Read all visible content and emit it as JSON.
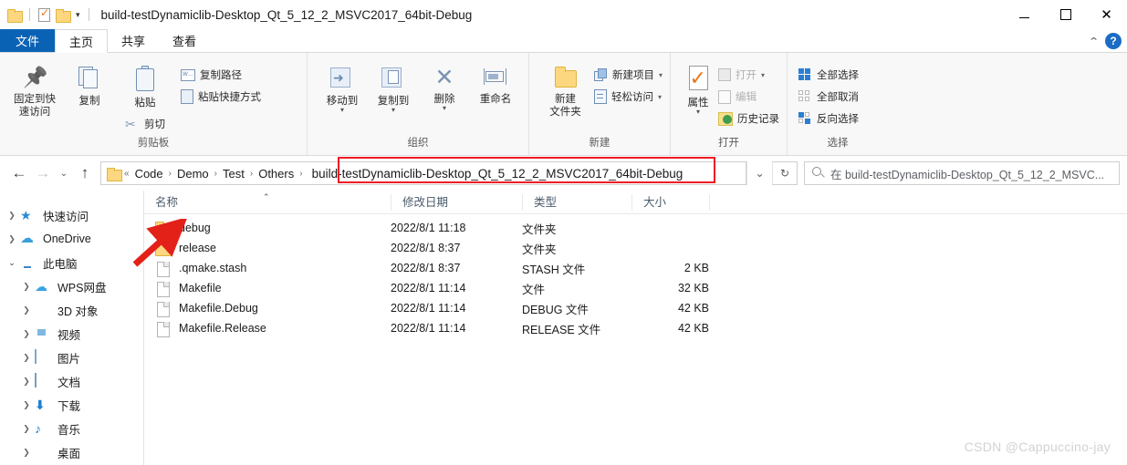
{
  "window": {
    "title": "build-testDynamiclib-Desktop_Qt_5_12_2_MSVC2017_64bit-Debug",
    "quick_access": [
      "folder-icon",
      "properties-icon",
      "folder-icon",
      "chevron-down-icon"
    ],
    "controls": {
      "minimize": "minimize-icon",
      "maximize": "maximize-icon",
      "close": "✕"
    }
  },
  "tabs": {
    "file": "文件",
    "items": [
      {
        "label": "主页",
        "active": true
      },
      {
        "label": "共享",
        "active": false
      },
      {
        "label": "查看",
        "active": false
      }
    ],
    "collapse": "︿",
    "help": "?"
  },
  "ribbon": {
    "groups": [
      {
        "label": "剪贴板",
        "big": [
          {
            "label": "固定到快\n速访问",
            "icon": "pin-icon"
          },
          {
            "label": "复制",
            "icon": "copy-icon"
          },
          {
            "label": "粘贴",
            "icon": "paste-icon"
          }
        ],
        "cut": {
          "label": "剪切",
          "icon": "scissors-icon"
        },
        "small": [
          {
            "label": "复制路径",
            "icon": "copy-path-icon"
          },
          {
            "label": "粘贴快捷方式",
            "icon": "paste-shortcut-icon"
          }
        ]
      },
      {
        "label": "组织",
        "big": [
          {
            "label": "移动到",
            "icon": "move-to-icon",
            "caret": true
          },
          {
            "label": "复制到",
            "icon": "copy-to-icon",
            "caret": true
          },
          {
            "label": "删除",
            "icon": "delete-icon",
            "caret": true
          },
          {
            "label": "重命名",
            "icon": "rename-icon"
          }
        ]
      },
      {
        "label": "新建",
        "big": [
          {
            "label": "新建\n文件夹",
            "icon": "new-folder-icon"
          }
        ],
        "small": [
          {
            "label": "新建项目",
            "icon": "new-item-icon",
            "caret": true
          },
          {
            "label": "轻松访问",
            "icon": "easy-access-icon",
            "caret": true
          }
        ]
      },
      {
        "label": "打开",
        "big": [
          {
            "label": "属性",
            "icon": "properties-icon",
            "caret": true
          }
        ],
        "small": [
          {
            "label": "打开",
            "icon": "open-icon",
            "caret": true,
            "disabled": true
          },
          {
            "label": "编辑",
            "icon": "edit-icon",
            "disabled": true
          },
          {
            "label": "历史记录",
            "icon": "history-icon"
          }
        ]
      },
      {
        "label": "选择",
        "small": [
          {
            "label": "全部选择",
            "icon": "select-all-icon"
          },
          {
            "label": "全部取消",
            "icon": "deselect-all-icon"
          },
          {
            "label": "反向选择",
            "icon": "invert-selection-icon"
          }
        ]
      }
    ]
  },
  "addressbar": {
    "back": "←",
    "forward": "→",
    "recent": "⌄",
    "up": "↑",
    "breadcrumb": [
      "Code",
      "Demo",
      "Test",
      "Others"
    ],
    "prefix": "«",
    "current": "build-testDynamiclib-Desktop_Qt_5_12_2_MSVC2017_64bit-Debug",
    "dropdown": "⌄",
    "refresh": "↻",
    "search_placeholder": "在 build-testDynamiclib-Desktop_Qt_5_12_2_MSVC..."
  },
  "sidebar": {
    "items": [
      {
        "label": "快速访问",
        "icon": "star-icon",
        "level": 1,
        "expanded": false
      },
      {
        "label": "OneDrive",
        "icon": "cloud-icon",
        "level": 1,
        "expanded": false
      },
      {
        "label": "此电脑",
        "icon": "this-pc-icon",
        "level": 1,
        "expanded": true
      },
      {
        "label": "WPS网盘",
        "icon": "wps-cloud-icon",
        "level": 2,
        "expanded": false
      },
      {
        "label": "3D 对象",
        "icon": "3d-objects-icon",
        "level": 2,
        "expanded": false
      },
      {
        "label": "视频",
        "icon": "videos-icon",
        "level": 2,
        "expanded": false
      },
      {
        "label": "图片",
        "icon": "pictures-icon",
        "level": 2,
        "expanded": false
      },
      {
        "label": "文档",
        "icon": "documents-icon",
        "level": 2,
        "expanded": false
      },
      {
        "label": "下载",
        "icon": "downloads-icon",
        "level": 2,
        "expanded": false
      },
      {
        "label": "音乐",
        "icon": "music-icon",
        "level": 2,
        "expanded": false
      },
      {
        "label": "桌面",
        "icon": "desktop-icon",
        "level": 2,
        "expanded": false
      }
    ]
  },
  "filelist": {
    "columns": [
      "名称",
      "修改日期",
      "类型",
      "大小"
    ],
    "sort_column": "名称",
    "sort_direction": "asc",
    "rows": [
      {
        "name": "debug",
        "date": "2022/8/1 11:18",
        "type": "文件夹",
        "size": "",
        "icon": "folder-icon"
      },
      {
        "name": "release",
        "date": "2022/8/1 8:37",
        "type": "文件夹",
        "size": "",
        "icon": "folder-icon"
      },
      {
        "name": ".qmake.stash",
        "date": "2022/8/1 8:37",
        "type": "STASH 文件",
        "size": "2 KB",
        "icon": "file-icon"
      },
      {
        "name": "Makefile",
        "date": "2022/8/1 11:14",
        "type": "文件",
        "size": "32 KB",
        "icon": "file-icon"
      },
      {
        "name": "Makefile.Debug",
        "date": "2022/8/1 11:14",
        "type": "DEBUG 文件",
        "size": "42 KB",
        "icon": "file-icon"
      },
      {
        "name": "Makefile.Release",
        "date": "2022/8/1 11:14",
        "type": "RELEASE 文件",
        "size": "42 KB",
        "icon": "file-icon"
      }
    ]
  },
  "annotations": {
    "highlight_color": "#ee1c25",
    "arrow_color": "#e32119",
    "watermark": "CSDN @Cappuccino-jay"
  }
}
